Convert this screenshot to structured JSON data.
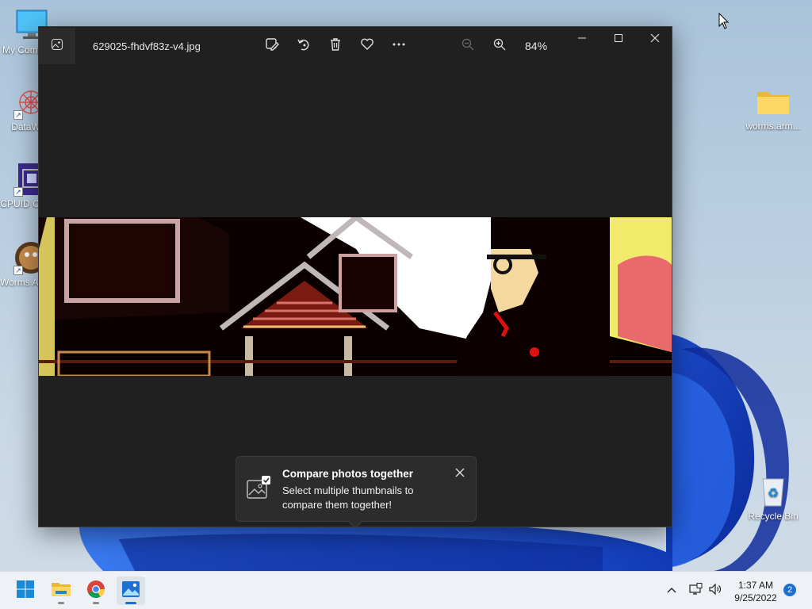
{
  "desktop": {
    "icons_left": [
      {
        "label": "My Computer",
        "icon": "monitor-icon"
      },
      {
        "label": "DataWag",
        "icon": "datawag-icon"
      },
      {
        "label": "CPUID CPU-Z",
        "icon": "cpuz-icon"
      },
      {
        "label": "Worms Armageddon",
        "icon": "worms-icon"
      }
    ],
    "icons_right": [
      {
        "label": "worms.arm...",
        "icon": "folder-icon"
      },
      {
        "label": "Recycle Bin",
        "icon": "recycle-bin-icon"
      }
    ]
  },
  "photos": {
    "filename": "629025-fhdvf83z-v4.jpg",
    "zoom_level": "84%",
    "toolbar": [
      "edit-image-icon",
      "rotate-icon",
      "delete-icon",
      "favorite-icon",
      "more-icon"
    ],
    "toast": {
      "title": "Compare photos together",
      "body": "Select multiple thumbnails to compare them together!"
    }
  },
  "taskbar": {
    "apps": [
      "start-icon",
      "file-explorer-icon",
      "chrome-icon",
      "photos-app-icon"
    ],
    "time": "1:37 AM",
    "date": "9/25/2022",
    "notification_count": "2"
  },
  "colors": {
    "window_bg": "#202020",
    "accent": "#1a6fd6"
  }
}
